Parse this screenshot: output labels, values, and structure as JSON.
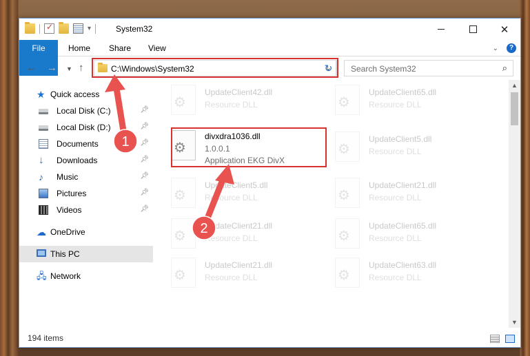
{
  "window": {
    "title": "System32"
  },
  "ribbon": {
    "tabs": [
      {
        "label": "File",
        "active": true
      },
      {
        "label": "Home"
      },
      {
        "label": "Share"
      },
      {
        "label": "View"
      }
    ],
    "help_glyph": "?"
  },
  "navigation": {
    "back_icon": "arrow-left-icon",
    "forward_icon": "arrow-right-icon",
    "up_icon": "arrow-up-icon",
    "address": "C:\\Windows\\System32",
    "search_placeholder": "Search System32"
  },
  "sidebar": {
    "items": [
      {
        "label": "Quick access",
        "icon": "star-icon",
        "pinned": false
      },
      {
        "label": "Local Disk (C:)",
        "icon": "drive-icon",
        "pinned": true
      },
      {
        "label": "Local Disk (D:)",
        "icon": "drive-icon",
        "pinned": true
      },
      {
        "label": "Documents",
        "icon": "documents-icon",
        "pinned": true
      },
      {
        "label": "Downloads",
        "icon": "download-icon",
        "pinned": true
      },
      {
        "label": "Music",
        "icon": "music-icon",
        "pinned": true
      },
      {
        "label": "Pictures",
        "icon": "pictures-icon",
        "pinned": true
      },
      {
        "label": "Videos",
        "icon": "videos-icon",
        "pinned": true
      },
      {
        "label": "OneDrive",
        "icon": "cloud-icon"
      },
      {
        "label": "This PC",
        "icon": "computer-icon",
        "selected": true
      },
      {
        "label": "Network",
        "icon": "network-icon"
      }
    ]
  },
  "files": {
    "left": [
      {
        "name": "UpdateClient42.dll",
        "type": "Resource DLL",
        "faded": true
      },
      {
        "name": "divxdra1036.dll",
        "version": "1.0.0.1",
        "type": "Application EKG DivX",
        "faded": false
      },
      {
        "name": "UpdateClient5.dll",
        "type": "Resource DLL",
        "faded": true
      },
      {
        "name": "UpdateClient21.dll",
        "type": "Resource DLL",
        "faded": true
      },
      {
        "name": "UpdateClient21.dll",
        "type": "Resource DLL",
        "faded": true
      }
    ],
    "right": [
      {
        "name": "UpdateClient65.dll",
        "type": "Resource DLL",
        "faded": true
      },
      {
        "name": "UpdateClient5.dll",
        "type": "Resource DLL",
        "faded": true
      },
      {
        "name": "UpdateClient21.dll",
        "type": "Resource DLL",
        "faded": true
      },
      {
        "name": "UpdateClient65.dll",
        "type": "Resource DLL",
        "faded": true
      },
      {
        "name": "UpdateClient63.dll",
        "type": "Resource DLL",
        "faded": true
      }
    ]
  },
  "status": {
    "item_count": "194 items"
  },
  "callouts": [
    {
      "number": "1"
    },
    {
      "number": "2"
    }
  ],
  "colors": {
    "accent": "#1979ca",
    "highlight": "#d9312f",
    "callout": "#e8524f"
  }
}
